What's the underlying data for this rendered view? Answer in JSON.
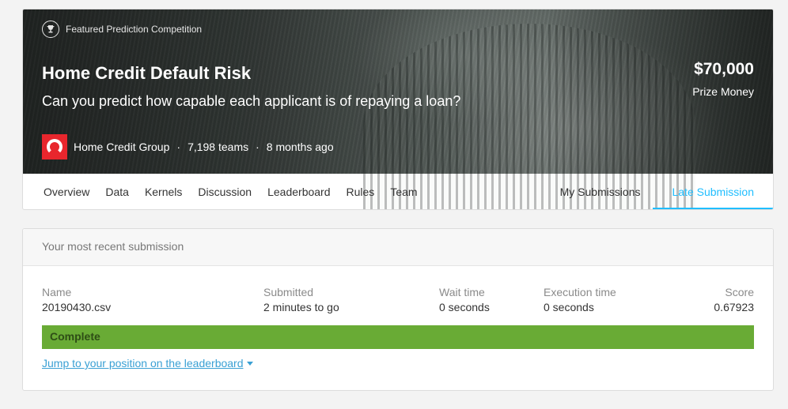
{
  "competition": {
    "badge": "Featured Prediction Competition",
    "badge_icon": "trophy-icon",
    "title": "Home Credit Default Risk",
    "subtitle": "Can you predict how capable each applicant is of repaying a loan?",
    "prize_amount": "$70,000",
    "prize_label": "Prize Money",
    "host": "Home Credit Group",
    "teams": "7,198 teams",
    "age": "8 months ago",
    "separator": "·",
    "host_logo_color": "#e8262d"
  },
  "tabs": {
    "left": [
      "Overview",
      "Data",
      "Kernels",
      "Discussion",
      "Leaderboard",
      "Rules",
      "Team"
    ],
    "my_submissions": "My Submissions",
    "late_submission": "Late Submission",
    "active": "Late Submission",
    "accent_color": "#20beff"
  },
  "submission": {
    "header": "Your most recent submission",
    "name_label": "Name",
    "name_value": "20190430.csv",
    "submitted_label": "Submitted",
    "submitted_value": "2 minutes to go",
    "wait_label": "Wait time",
    "wait_value": "0 seconds",
    "exec_label": "Execution time",
    "exec_value": "0 seconds",
    "score_label": "Score",
    "score_value": "0.67923",
    "status": "Complete",
    "status_color": "#69ab35",
    "jump_link": "Jump to your position on the leaderboard"
  }
}
